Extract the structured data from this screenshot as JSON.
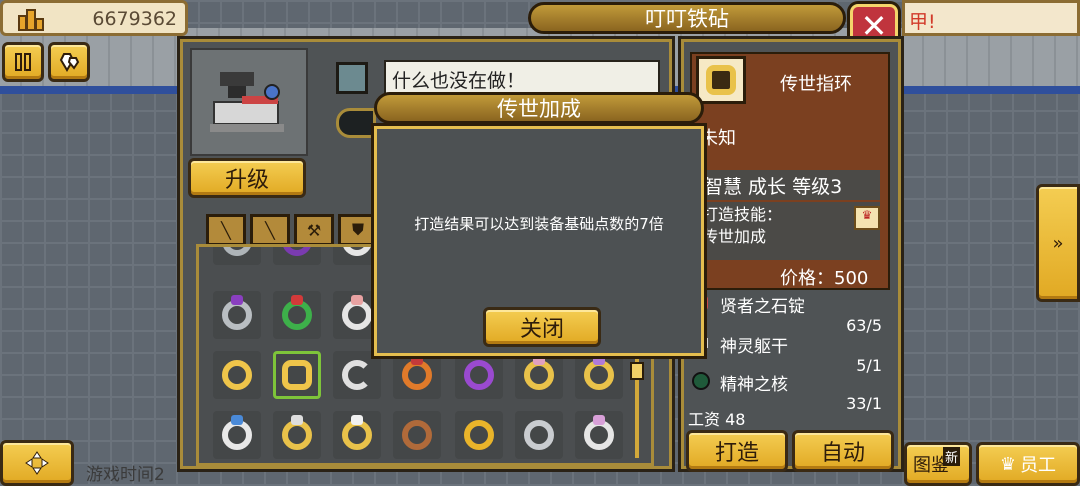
{
  "top": {
    "money": "6679362",
    "title": "叮叮铁砧",
    "alert": "甲!"
  },
  "left_controls": {
    "pause_icon": "pause-icon",
    "gem_icon": "gems-icon",
    "dpad_icon": "dpad-icon"
  },
  "workshop": {
    "status_text": "什么也没在做！",
    "upgrade_label": "升级",
    "category_icons": [
      "sword-icon",
      "spear-icon",
      "axe-icon",
      "shield-icon"
    ]
  },
  "dialog": {
    "title": "传世加成",
    "text": "打造结果可以达到装备基础点数的7倍",
    "close_label": "关闭"
  },
  "detail": {
    "item_name": "传世指环",
    "unknown_text": "未知",
    "stat_line": "智慧 成长 等级3",
    "skill_label": "打造技能：",
    "skill_value": "传世加成",
    "price": "价格：500",
    "materials": [
      {
        "name": "贤者之石锭",
        "count": "63/5"
      },
      {
        "name": "神灵躯干",
        "count": "5/1"
      },
      {
        "name": "精神之核",
        "count": "33/1"
      }
    ],
    "wage": "工资 48",
    "craft_label": "打造",
    "auto_label": "自动"
  },
  "bottom": {
    "compendium_label": "图鉴",
    "new_badge": "新",
    "staff_label": "员工",
    "game_time": "游戏时间2"
  },
  "colors": {
    "gold": "#e1a923",
    "panel": "#4f5355",
    "detail_brown": "#7b4020",
    "close_red": "#c0343d",
    "selected_green": "#7ec43a"
  }
}
